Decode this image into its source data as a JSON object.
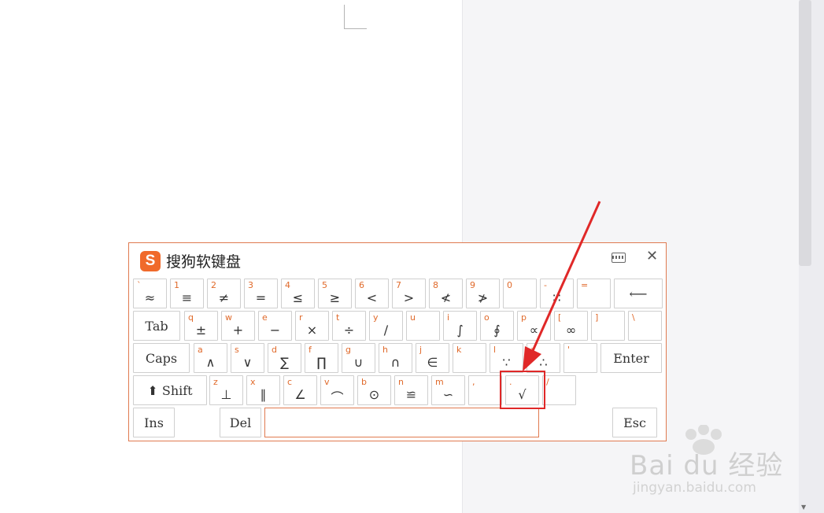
{
  "keyboard": {
    "logo": "S",
    "title": "搜狗软键盘",
    "close": "✕"
  },
  "rows": [
    [
      {
        "key": "`",
        "sym": "≈"
      },
      {
        "key": "1",
        "sym": "≡"
      },
      {
        "key": "2",
        "sym": "≠"
      },
      {
        "key": "3",
        "sym": "="
      },
      {
        "key": "4",
        "sym": "≤"
      },
      {
        "key": "5",
        "sym": "≥"
      },
      {
        "key": "6",
        "sym": "<"
      },
      {
        "key": "7",
        "sym": ">"
      },
      {
        "key": "8",
        "sym": "≮"
      },
      {
        "key": "9",
        "sym": "≯"
      },
      {
        "key": "0",
        "sym": ""
      },
      {
        "key": "-",
        "sym": "∷"
      },
      {
        "key": "=",
        "sym": ""
      },
      {
        "fn": "⟵"
      }
    ],
    [
      {
        "fn": "Tab"
      },
      {
        "key": "q",
        "sym": "±"
      },
      {
        "key": "w",
        "sym": "+"
      },
      {
        "key": "e",
        "sym": "−"
      },
      {
        "key": "r",
        "sym": "×"
      },
      {
        "key": "t",
        "sym": "÷"
      },
      {
        "key": "y",
        "sym": "∕"
      },
      {
        "key": "u",
        "sym": ""
      },
      {
        "key": "i",
        "sym": "∫"
      },
      {
        "key": "o",
        "sym": "∮"
      },
      {
        "key": "p",
        "sym": "∝"
      },
      {
        "key": "[",
        "sym": "∞"
      },
      {
        "key": "]",
        "sym": ""
      },
      {
        "key": "\\",
        "sym": ""
      }
    ],
    [
      {
        "fn": "Caps"
      },
      {
        "key": "a",
        "sym": "∧"
      },
      {
        "key": "s",
        "sym": "∨"
      },
      {
        "key": "d",
        "sym": "∑"
      },
      {
        "key": "f",
        "sym": "∏"
      },
      {
        "key": "g",
        "sym": "∪"
      },
      {
        "key": "h",
        "sym": "∩"
      },
      {
        "key": "j",
        "sym": "∈"
      },
      {
        "key": "k",
        "sym": ""
      },
      {
        "key": "l",
        "sym": "∵"
      },
      {
        "key": ";",
        "sym": "∴"
      },
      {
        "key": "'",
        "sym": ""
      },
      {
        "fn": "Enter"
      }
    ],
    [
      {
        "fn": "⬆ Shift"
      },
      {
        "key": "z",
        "sym": "⊥"
      },
      {
        "key": "x",
        "sym": "∥"
      },
      {
        "key": "c",
        "sym": "∠"
      },
      {
        "key": "v",
        "sym": "⌒"
      },
      {
        "key": "b",
        "sym": "⊙"
      },
      {
        "key": "n",
        "sym": "≌"
      },
      {
        "key": "m",
        "sym": "∽"
      },
      {
        "key": ",",
        "sym": ""
      },
      {
        "key": ".",
        "sym": "√"
      },
      {
        "key": "/",
        "sym": ""
      }
    ],
    [
      {
        "fn": "Ins"
      },
      {
        "fn": "Del"
      },
      {
        "fn": "Esc"
      }
    ]
  ],
  "watermark": {
    "brand": "Bai  du 经验",
    "url": "jingyan.baidu.com"
  },
  "accent_color": "#e06a2b",
  "highlight_color": "#e02828"
}
